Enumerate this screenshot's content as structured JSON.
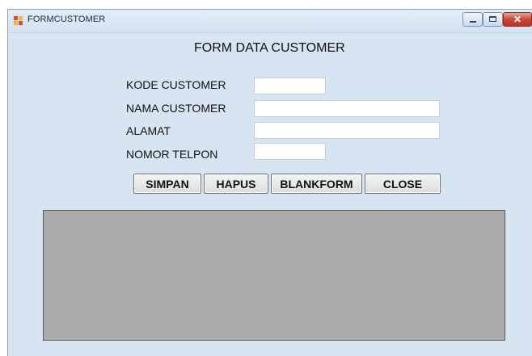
{
  "window": {
    "title": "FORMCUSTOMER",
    "controls": {
      "minimize": "minimize",
      "maximize": "maximize",
      "close": "✕"
    }
  },
  "form": {
    "heading": "FORM DATA CUSTOMER",
    "fields": {
      "kode": {
        "label": "KODE CUSTOMER",
        "value": ""
      },
      "nama": {
        "label": "NAMA CUSTOMER",
        "value": ""
      },
      "alamat": {
        "label": "ALAMAT",
        "value": ""
      },
      "telpon": {
        "label": "NOMOR TELPON",
        "value": ""
      }
    },
    "buttons": {
      "simpan": "SIMPAN",
      "hapus": "HAPUS",
      "blankform": "BLANKFORM",
      "close": "CLOSE"
    }
  },
  "colors": {
    "form_background": "#d7e4f2",
    "grid_background": "#ababab",
    "close_button_red": "#c9493a"
  },
  "icons": {
    "app_icon": "form-app-icon",
    "minimize": "minimize-icon",
    "maximize": "maximize-icon",
    "close": "close-icon"
  }
}
